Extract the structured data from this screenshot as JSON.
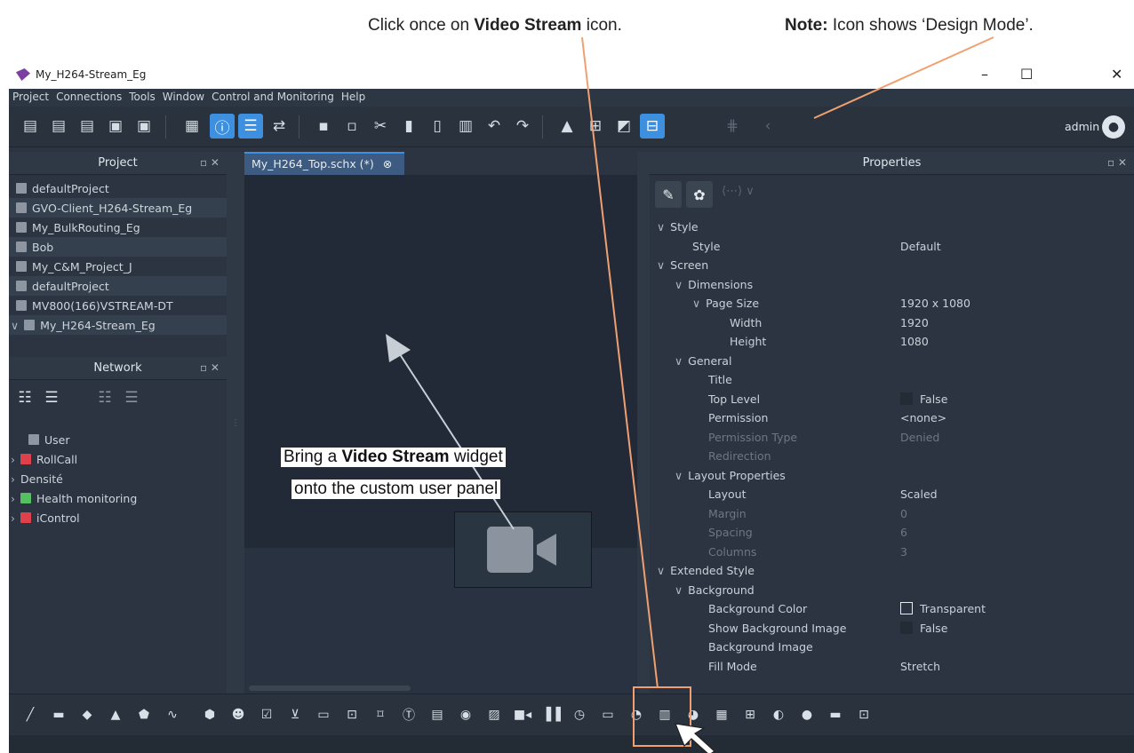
{
  "annotations": {
    "note_left_prefix": "Click once on ",
    "note_left_bold": "Video Stream",
    "note_left_suffix": " icon.",
    "note_right_bold": "Note:",
    "note_right_text": " Icon shows ‘Design Mode’.",
    "callout_line1_prefix": "Bring a ",
    "callout_line1_bold": "Video Stream",
    "callout_line1_suffix": " widget",
    "callout_line2": "onto the custom user panel",
    "accent_color": "#f0a070"
  },
  "window": {
    "title": "My_H264-Stream_Eg",
    "controls": {
      "minimize": "–",
      "maximize": "☐",
      "close": "✕"
    }
  },
  "menu": [
    "Project",
    "Connections",
    "Tools",
    "Window",
    "Control and Monitoring",
    "Help"
  ],
  "toolbar": {
    "user": "admin",
    "icons": [
      "new-project-icon",
      "download-project-icon",
      "upload-project-icon",
      "save-icon",
      "save-as-icon",
      "project-manager-icon",
      "info-icon",
      "tree-icon",
      "swap-icon",
      "grid-large-icon",
      "grid-small-icon",
      "cut-icon",
      "copy-icon",
      "paste-icon",
      "delete-icon",
      "undo-icon",
      "redo-icon",
      "lock-icon",
      "table-icon",
      "window-icon",
      "design-mode-icon",
      "grid-snap-icon",
      "back-icon"
    ]
  },
  "project_panel": {
    "title": "Project",
    "items": [
      "defaultProject",
      "GVO-Client_H264-Stream_Eg",
      "My_BulkRouting_Eg",
      "Bob",
      "My_C&M_Project_J",
      "defaultProject",
      "MV800(166)VSTREAM-DT",
      "My_H264-Stream_Eg"
    ]
  },
  "network_panel": {
    "title": "Network",
    "items": [
      {
        "label": "User",
        "color": "#8d96a1",
        "expandable": false
      },
      {
        "label": "RollCall",
        "color": "#e0404a",
        "expandable": true
      },
      {
        "label": "Densité",
        "color": "",
        "expandable": true
      },
      {
        "label": "Health monitoring",
        "color": "#55c060",
        "expandable": true
      },
      {
        "label": "iControl",
        "color": "#e0404a",
        "expandable": true
      }
    ]
  },
  "editor": {
    "tab_label": "My_H264_Top.schx (*)"
  },
  "properties": {
    "title": "Properties",
    "rows": [
      {
        "key": "Style",
        "value": "",
        "level": 0,
        "tri": true
      },
      {
        "key": "Style",
        "value": "Default",
        "level": 2,
        "tri": false
      },
      {
        "key": "Screen",
        "value": "",
        "level": 0,
        "tri": true
      },
      {
        "key": "Dimensions",
        "value": "",
        "level": 1,
        "tri": true
      },
      {
        "key": "Page Size",
        "value": "1920 x 1080",
        "level": 2,
        "tri": true
      },
      {
        "key": "Width",
        "value": "1920",
        "level": 4,
        "tri": false
      },
      {
        "key": "Height",
        "value": "1080",
        "level": 4,
        "tri": false
      },
      {
        "key": "General",
        "value": "",
        "level": 1,
        "tri": true
      },
      {
        "key": "Title",
        "value": "",
        "level": 3,
        "tri": false
      },
      {
        "key": "Top Level",
        "value": "False",
        "level": 3,
        "tri": false,
        "check": true
      },
      {
        "key": "Permission",
        "value": "<none>",
        "level": 3,
        "tri": false
      },
      {
        "key": "Permission Type",
        "value": "Denied",
        "level": 3,
        "tri": false,
        "dim": true
      },
      {
        "key": "Redirection",
        "value": "",
        "level": 3,
        "tri": false,
        "dim": true
      },
      {
        "key": "Layout Properties",
        "value": "",
        "level": 1,
        "tri": true
      },
      {
        "key": "Layout",
        "value": "Scaled",
        "level": 3,
        "tri": false
      },
      {
        "key": "Margin",
        "value": "0",
        "level": 3,
        "tri": false,
        "dim": true
      },
      {
        "key": "Spacing",
        "value": "6",
        "level": 3,
        "tri": false,
        "dim": true
      },
      {
        "key": "Columns",
        "value": "3",
        "level": 3,
        "tri": false,
        "dim": true
      },
      {
        "key": "Extended Style",
        "value": "",
        "level": 0,
        "tri": true
      },
      {
        "key": "Background",
        "value": "",
        "level": 1,
        "tri": true
      },
      {
        "key": "Background Color",
        "value": "Transparent",
        "level": 3,
        "tri": false,
        "swatch": true
      },
      {
        "key": "Show Background Image",
        "value": "False",
        "level": 3,
        "tri": false,
        "check": true
      },
      {
        "key": "Background Image",
        "value": "",
        "level": 3,
        "tri": false
      },
      {
        "key": "Fill Mode",
        "value": "Stretch",
        "level": 3,
        "tri": false
      }
    ]
  },
  "widget_bar": {
    "icons": [
      "line-icon",
      "rectangle-icon",
      "ellipse-icon",
      "triangle-icon",
      "polygon-icon",
      "path-icon",
      "box-icon",
      "smiley-icon",
      "checkbox-icon",
      "combobox-icon",
      "slider-icon",
      "label-icon",
      "frame-icon",
      "text-icon",
      "list-icon",
      "button-icon",
      "image-icon",
      "video-stream-icon",
      "bar-meter-icon",
      "clock-icon",
      "counter-icon",
      "timer-icon",
      "chart-icon",
      "pie-icon",
      "alarm-icon",
      "grid-icon",
      "gauge-icon",
      "led-icon",
      "separator-icon",
      "panel-icon"
    ]
  }
}
